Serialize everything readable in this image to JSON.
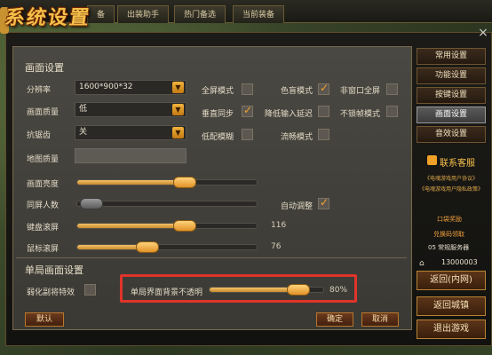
{
  "header": {
    "title": "系统设置",
    "tabs": [
      "备",
      "出装助手",
      "热门备选",
      "当前装备"
    ]
  },
  "close_symbol": "×",
  "display_section": {
    "title": "画面设置",
    "resolution_label": "分辨率",
    "resolution_value": "1600*900*32",
    "quality_label": "画面质量",
    "quality_value": "低",
    "antialias_label": "抗锯齿",
    "antialias_value": "关",
    "map_quality_label": "地图质量",
    "brightness_label": "画面亮度",
    "brightness_level": 0.6,
    "same_screen_label": "同屏人数",
    "same_screen_level": 0.08,
    "auto_adjust_label": "自动调整",
    "keyboard_scroll_label": "键盘滚屏",
    "keyboard_scroll_value": "116",
    "keyboard_scroll_level": 0.6,
    "mouse_scroll_label": "鼠标滚屏",
    "mouse_scroll_value": "76",
    "mouse_scroll_level": 0.39
  },
  "checkboxes": {
    "fullscreen": {
      "label": "全屏模式",
      "checked": false
    },
    "color_blind": {
      "label": "色盲模式",
      "checked": true
    },
    "non_window_full": {
      "label": "非窗口全屏",
      "checked": false
    },
    "vsync": {
      "label": "垂直同步",
      "checked": true
    },
    "reduce_input_delay": {
      "label": "降低输入延迟",
      "checked": false
    },
    "unlock_fps": {
      "label": "不锁帧模式",
      "checked": false
    },
    "low_blur": {
      "label": "低配模糊",
      "checked": false
    },
    "smooth_mode": {
      "label": "流畅模式",
      "checked": false
    },
    "auto_adjust": {
      "checked": true
    },
    "weaken_vice": {
      "label": "弱化副将特效",
      "checked": false
    }
  },
  "single_section": {
    "title": "单局画面设置",
    "opacity_label": "单局界面背景不透明",
    "opacity_value": "80%",
    "opacity_level": 0.78
  },
  "buttons": {
    "default": "默认",
    "ok": "确定",
    "cancel": "取消"
  },
  "menu": {
    "items": [
      "常用设置",
      "功能设置",
      "按键设置",
      "画面设置",
      "音效设置"
    ],
    "active": "画面设置"
  },
  "service": {
    "title": "联系客服",
    "link1": "《电魂游戏用户协议》",
    "link2": "《电魂游戏用户隐私政策》",
    "reward": "口袋奖励",
    "redeem": "兑换码领取",
    "server": "05 常规服务器",
    "id": "13000003"
  },
  "side_buttons": {
    "back_lobby": "返回(内网)",
    "back_city": "返回城镇",
    "exit": "退出游戏"
  }
}
